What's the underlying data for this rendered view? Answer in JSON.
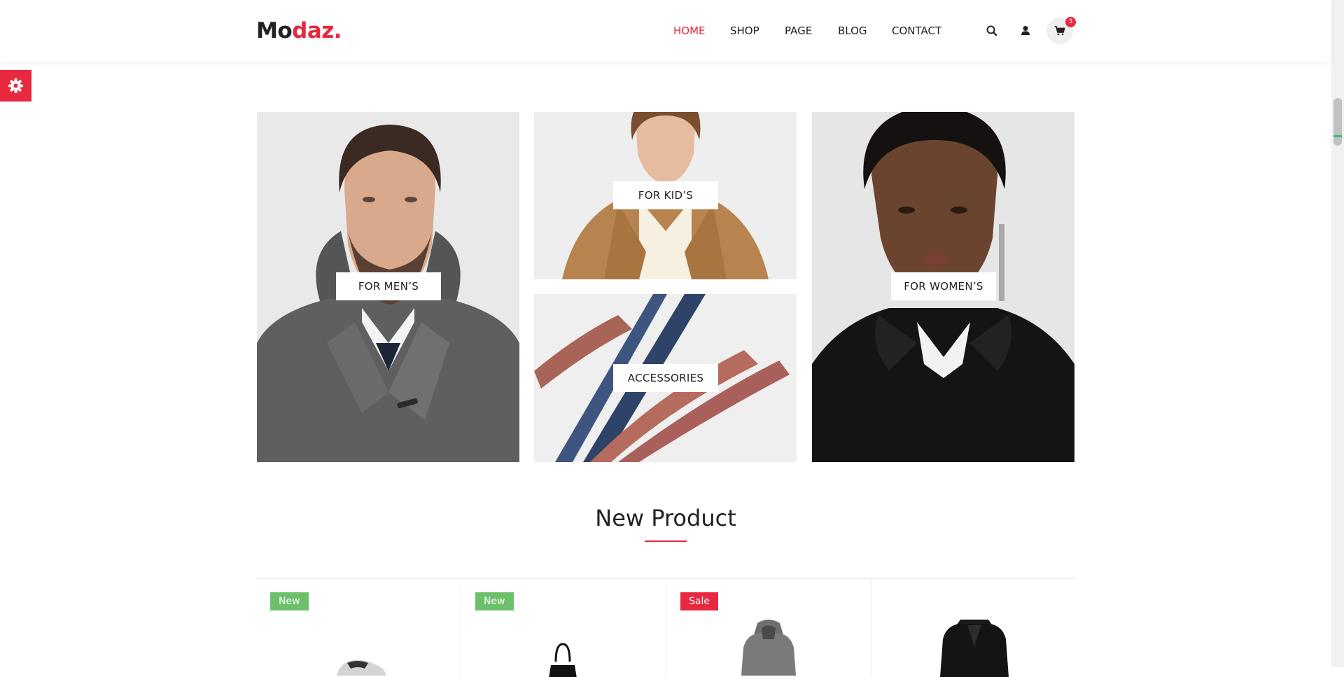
{
  "brand": {
    "part1": "Mo",
    "part2": "daz."
  },
  "nav": {
    "items": [
      {
        "label": "HOME",
        "active": true
      },
      {
        "label": "SHOP",
        "active": false
      },
      {
        "label": "PAGE",
        "active": false
      },
      {
        "label": "BLOG",
        "active": false
      },
      {
        "label": "CONTACT",
        "active": false
      }
    ]
  },
  "header_icons": {
    "search": "search-icon",
    "account": "user-icon",
    "cart": "cart-icon"
  },
  "cart": {
    "count": "3"
  },
  "settings": {
    "icon": "gear-icon"
  },
  "banners": [
    {
      "label": "FOR MEN’S"
    },
    {
      "label": "FOR KID’S"
    },
    {
      "label": "ACCESSORIES"
    },
    {
      "label": "FOR WOMEN’S"
    }
  ],
  "section": {
    "title": "New Product"
  },
  "products": [
    {
      "tag": "New",
      "tag_type": "new",
      "image": "sneaker"
    },
    {
      "tag": "New",
      "tag_type": "new",
      "image": "handbag"
    },
    {
      "tag": "Sale",
      "tag_type": "sale",
      "image": "grey-hooded-coat"
    },
    {
      "tag": "",
      "tag_type": "",
      "image": "black-blazer"
    }
  ],
  "colors": {
    "accent": "#e7283e",
    "new_badge": "#6dc06a",
    "text": "#222222"
  }
}
